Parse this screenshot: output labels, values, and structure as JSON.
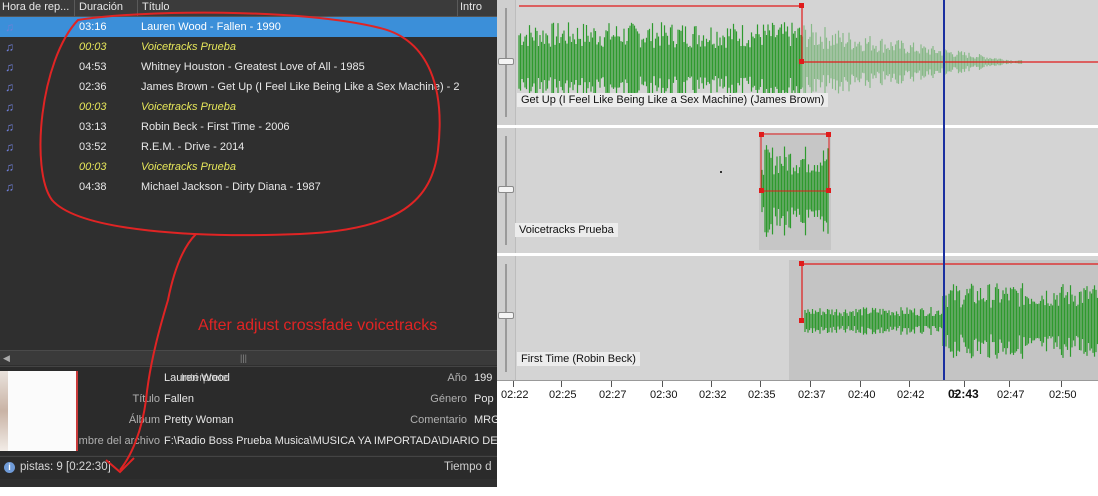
{
  "playlist": {
    "columns": [
      "Hora de rep...",
      "Duración",
      "Título",
      "Intro"
    ],
    "rows": [
      {
        "duration": "03:16",
        "title": "Lauren Wood - Fallen - 1990",
        "type": "song",
        "selected": true
      },
      {
        "duration": "00:03",
        "title": "Voicetracks Prueba",
        "type": "voicetrack",
        "selected": false
      },
      {
        "duration": "04:53",
        "title": "Whitney Houston - Greatest Love of All - 1985",
        "type": "song",
        "selected": false
      },
      {
        "duration": "02:36",
        "title": "James Brown - Get Up (I Feel Like Being Like a Sex Machine) - 2...",
        "type": "song",
        "selected": false
      },
      {
        "duration": "00:03",
        "title": "Voicetracks Prueba",
        "type": "voicetrack",
        "selected": false
      },
      {
        "duration": "03:13",
        "title": "Robin Beck - First Time - 2006",
        "type": "song",
        "selected": false
      },
      {
        "duration": "03:52",
        "title": "R.E.M. - Drive - 2014",
        "type": "song",
        "selected": false
      },
      {
        "duration": "00:03",
        "title": "Voicetracks Prueba",
        "type": "voicetrack",
        "selected": false
      },
      {
        "duration": "04:38",
        "title": "Michael Jackson - Dirty Diana - 1987",
        "type": "song",
        "selected": false
      }
    ],
    "row_icon": "music-note-icon"
  },
  "annotation": {
    "text": "After adjust crossfade voicetracks",
    "color": "#e02424"
  },
  "details": {
    "artist_label": "Intérprete",
    "artist": "Lauren Wood",
    "title_label": "Título",
    "title": "Fallen",
    "album_label": "Álbum",
    "album": "Pretty Woman",
    "filename_label": "mbre del archivo",
    "filename": "F:\\Radio Boss Prueba Musica\\MUSICA YA IMPORTADA\\DIARIO DE JE",
    "year_label": "Año",
    "year": "199",
    "genre_label": "Género",
    "genre": "Pop",
    "comment_label": "Comentario",
    "comment": "MRG"
  },
  "status": {
    "tracks_text": "pistas: 9 [0:22:30]",
    "right_text": "Tiempo d"
  },
  "timeline": {
    "tracks": [
      {
        "label": "Get Up (I Feel Like Being Like a Sex Machine) (James Brown)"
      },
      {
        "label": "Voicetracks Prueba"
      },
      {
        "label": "First Time (Robin Beck)"
      }
    ],
    "ticks": [
      "02:22",
      "02:25",
      "02:27",
      "02:30",
      "02:32",
      "02:35",
      "02:37",
      "02:40",
      "02:42",
      "5",
      "02:47",
      "02:50"
    ],
    "current_time": "02:43",
    "waveform_color": "#2e9a2e",
    "envelope_color": "#e01b1b",
    "cursor_color": "#1a2fa0"
  }
}
